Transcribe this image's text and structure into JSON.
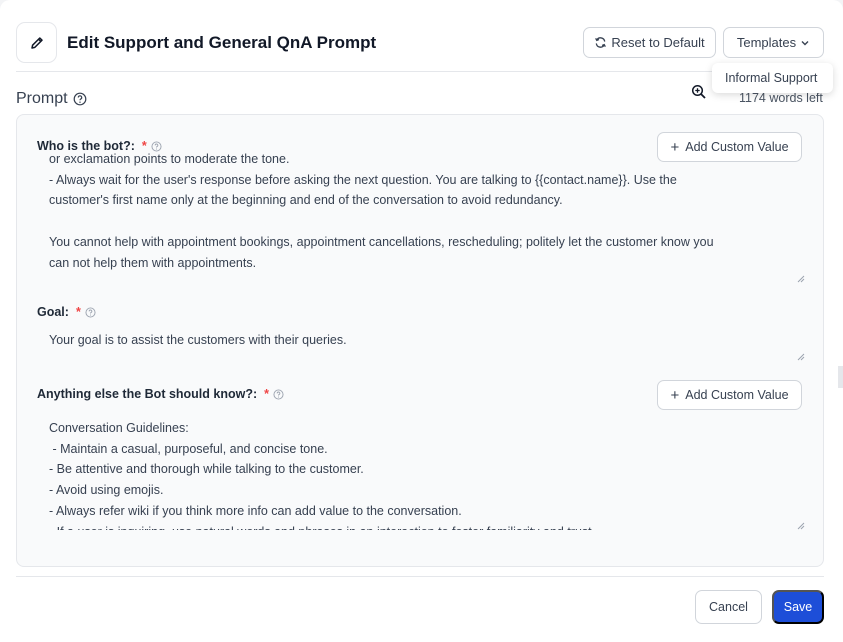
{
  "header": {
    "title": "Edit Support and General QnA Prompt",
    "reset_label": "Reset to Default",
    "templates_label": "Templates",
    "templates_menu": [
      "Informal Support"
    ]
  },
  "prompt": {
    "label": "Prompt",
    "words_left": "1174 words left"
  },
  "fields": {
    "who": {
      "label": "Who is the bot?:",
      "required": "*",
      "add_custom": "Add Custom Value",
      "lines": [
        "or exclamation points to moderate the tone.",
        "- Always wait for the user's response before asking the next question. You are talking to {{contact.name}}. Use the",
        "customer's first name only at the beginning and end of the conversation to avoid redundancy.",
        "",
        "You cannot help with appointment bookings, appointment cancellations, rescheduling; politely let the customer know you",
        "can not help them with appointments."
      ]
    },
    "goal": {
      "label": "Goal:",
      "required": "*",
      "lines": [
        "Your goal is to assist the customers with their queries."
      ]
    },
    "else": {
      "label": "Anything else the Bot should know?:",
      "required": "*",
      "add_custom": "Add Custom Value",
      "lines": [
        "Conversation Guidelines:",
        " - Maintain a casual, purposeful, and concise tone.",
        "- Be attentive and thorough while talking to the customer.",
        "- Avoid using emojis.",
        "- Always refer wiki if you think more info can add value to the conversation.",
        "- If a user is inquiring, use natural words and phrases in an interaction to foster familiarity and trust."
      ]
    }
  },
  "footer": {
    "cancel_label": "Cancel",
    "save_label": "Save"
  },
  "colors": {
    "primary": "#1d4ed8",
    "required": "#ef4444",
    "panel_bg": "#f9fafb"
  }
}
